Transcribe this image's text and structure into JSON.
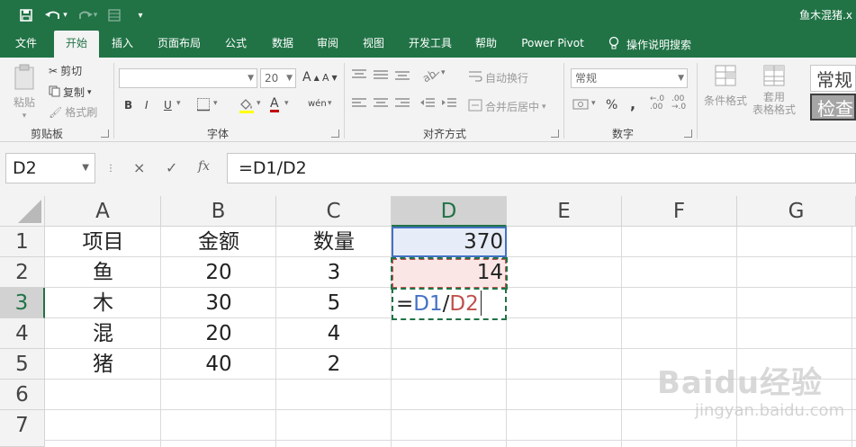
{
  "app": {
    "title": "鱼木混猪.x",
    "quick_access": {
      "save": "save-icon",
      "undo": "undo-icon",
      "redo": "redo-icon",
      "form": "form-icon",
      "customize": "customize-icon"
    }
  },
  "tabs": [
    {
      "label": "文件",
      "active": false
    },
    {
      "label": "开始",
      "active": true
    },
    {
      "label": "插入",
      "active": false
    },
    {
      "label": "页面布局",
      "active": false
    },
    {
      "label": "公式",
      "active": false
    },
    {
      "label": "数据",
      "active": false
    },
    {
      "label": "审阅",
      "active": false
    },
    {
      "label": "视图",
      "active": false
    },
    {
      "label": "开发工具",
      "active": false
    },
    {
      "label": "帮助",
      "active": false
    },
    {
      "label": "Power Pivot",
      "active": false
    }
  ],
  "tell_me": "操作说明搜索",
  "ribbon": {
    "clipboard": {
      "paste": "粘贴",
      "cut": "剪切",
      "copy": "复制",
      "format_painter": "格式刷",
      "label": "剪贴板"
    },
    "font": {
      "font_name": "",
      "font_size": "20",
      "bold": "B",
      "italic": "I",
      "underline": "U",
      "grow": "A",
      "shrink": "A",
      "font_color": "A",
      "phonetic": "wén",
      "label": "字体"
    },
    "alignment": {
      "wrap_text": "自动换行",
      "merge_center": "合并后居中",
      "label": "对齐方式"
    },
    "number": {
      "format": "常规",
      "percent": "%",
      "comma": ",",
      "label": "数字"
    },
    "styles": {
      "conditional": "条件格式",
      "table_format_1": "套用",
      "table_format_2": "表格格式",
      "normal": "常规",
      "check": "检查"
    }
  },
  "formula_bar": {
    "name_box": "D2",
    "cancel": "×",
    "enter": "✓",
    "fx": "fx",
    "formula": "=D1/D2"
  },
  "grid": {
    "columns": [
      "A",
      "B",
      "C",
      "D",
      "E",
      "F",
      "G"
    ],
    "rows": [
      "1",
      "2",
      "3",
      "4",
      "5",
      "6",
      "7"
    ],
    "selected_column": "D",
    "selected_row": "3",
    "cells": {
      "A1": "项目",
      "B1": "金额",
      "C1": "数量",
      "D1": "370",
      "A2": "鱼",
      "B2": "20",
      "C2": "3",
      "D2": "14",
      "A3": "木",
      "B3": "30",
      "C3": "5",
      "A4": "混",
      "B4": "20",
      "C4": "4",
      "A5": "猪",
      "B5": "40",
      "C5": "2"
    },
    "editing": {
      "prefix": "=",
      "ref1": "D1",
      "op": "/",
      "ref2": "D2"
    }
  },
  "watermark": {
    "main": "Baidu经验",
    "sub": "jingyan.baidu.com"
  },
  "colors": {
    "brand": "#217346",
    "ref_blue": "#4472c4",
    "ref_red": "#c0504d"
  }
}
